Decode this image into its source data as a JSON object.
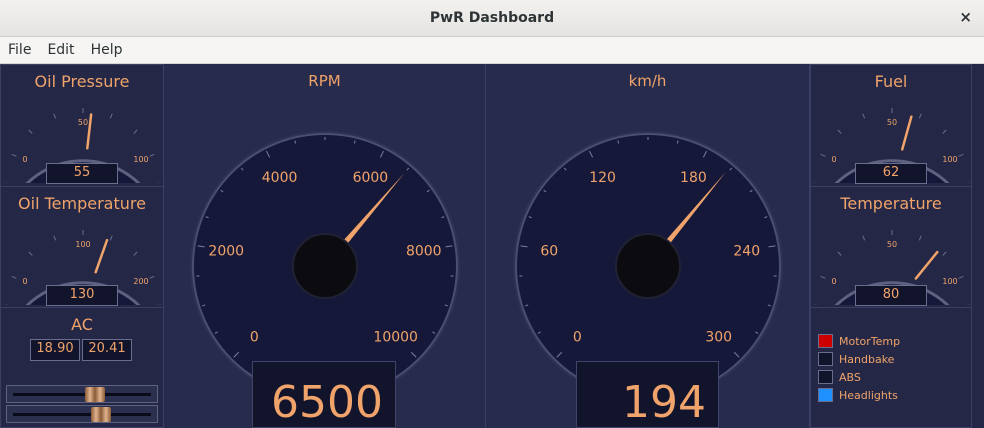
{
  "window": {
    "title": "PwR Dashboard",
    "close_glyph": "×"
  },
  "menu": [
    "File",
    "Edit",
    "Help"
  ],
  "small_gauges": [
    {
      "id": "oil-pressure",
      "label": "Oil Pressure",
      "ticks": [
        "0",
        "50",
        "100"
      ],
      "min": 0,
      "max": 100,
      "value": 55,
      "display": "55"
    },
    {
      "id": "oil-temperature",
      "label": "Oil Temperature",
      "ticks": [
        "0",
        "100",
        "200"
      ],
      "min": 0,
      "max": 200,
      "value": 130,
      "display": "130"
    },
    {
      "id": "fuel",
      "label": "Fuel",
      "ticks": [
        "0",
        "50",
        "100"
      ],
      "min": 0,
      "max": 100,
      "value": 62,
      "display": "62"
    },
    {
      "id": "temperature",
      "label": "Temperature",
      "ticks": [
        "0",
        "50",
        "100"
      ],
      "min": 0,
      "max": 100,
      "value": 80,
      "display": "80"
    }
  ],
  "ac": {
    "label": "AC",
    "left_value": "18.90",
    "right_value": "20.41"
  },
  "sliders": [
    {
      "value": 0.61
    },
    {
      "value": 0.66
    }
  ],
  "big_gauges": [
    {
      "id": "rpm",
      "label": "RPM",
      "ticks": [
        "0",
        "2000",
        "4000",
        "6000",
        "8000",
        "10000"
      ],
      "min": 0,
      "max": 10000,
      "value": 6500,
      "display": "6500"
    },
    {
      "id": "kmh",
      "label": "km/h",
      "ticks": [
        "0",
        "60",
        "120",
        "180",
        "240",
        "300"
      ],
      "min": 0,
      "max": 300,
      "value": 194,
      "display": "194"
    }
  ],
  "indicators": [
    {
      "label": "MotorTemp",
      "color": "#cc0000"
    },
    {
      "label": "Handbake",
      "color": "#12142c"
    },
    {
      "label": "ABS",
      "color": "#12142c"
    },
    {
      "label": "Headlights",
      "color": "#1e90ff"
    }
  ],
  "colors": {
    "accent": "#f0a36a",
    "panel": "#242846",
    "dial": "#16183a"
  }
}
